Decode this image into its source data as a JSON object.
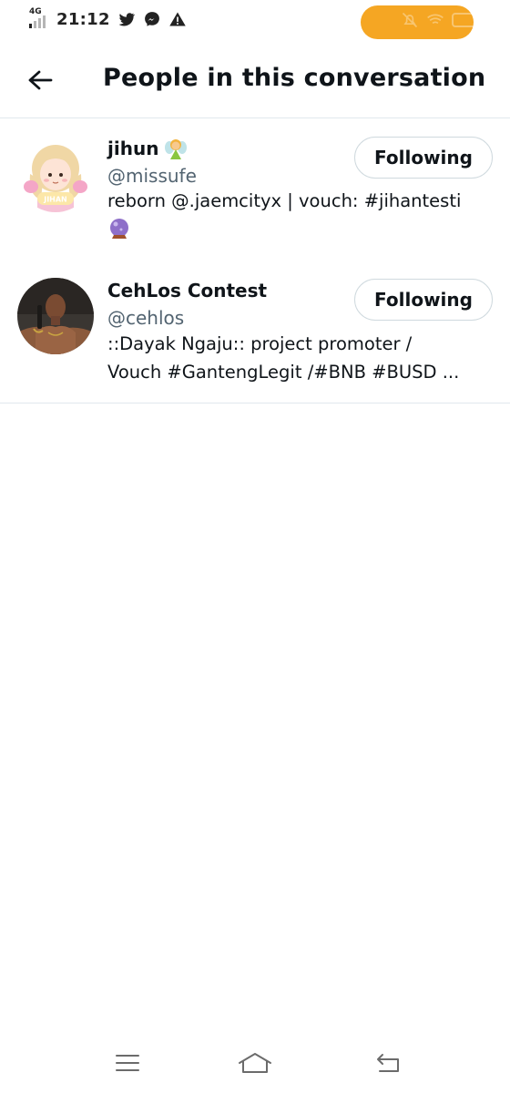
{
  "status_bar": {
    "network": "4G",
    "time": "21:12",
    "icons": [
      "signal-icon",
      "twitter-icon",
      "messenger-icon",
      "warning-icon",
      "mute-icon",
      "wifi-icon",
      "battery-icon"
    ],
    "pill_color": "#f5a623"
  },
  "header": {
    "back_icon": "arrow-left-icon",
    "title": "People in this conversation"
  },
  "users": [
    {
      "name": "jihun",
      "name_emoji": "fairy-emoji",
      "handle": "@missufe",
      "bio_line1": "reborn @.jaemcityx | vouch: #jihantesti",
      "bio_icon": "crystal-ball-emoji",
      "avatar_text": "JIHAN",
      "button": "Following"
    },
    {
      "name": "CehLos Contest",
      "handle": "@cehlos",
      "bio_line1": "::Dayak Ngaju:: project promoter /",
      "bio_line2": "Vouch #GantengLegit /#BNB #BUSD ...",
      "button": "Following"
    }
  ],
  "nav_bar": {
    "icons": [
      "menu-icon",
      "home-icon",
      "back-icon"
    ]
  },
  "colors": {
    "text_primary": "#0f1419",
    "text_secondary": "#536471",
    "divider": "#e1e8ed",
    "button_border": "#cfd9de",
    "status_pill": "#f5a623"
  }
}
